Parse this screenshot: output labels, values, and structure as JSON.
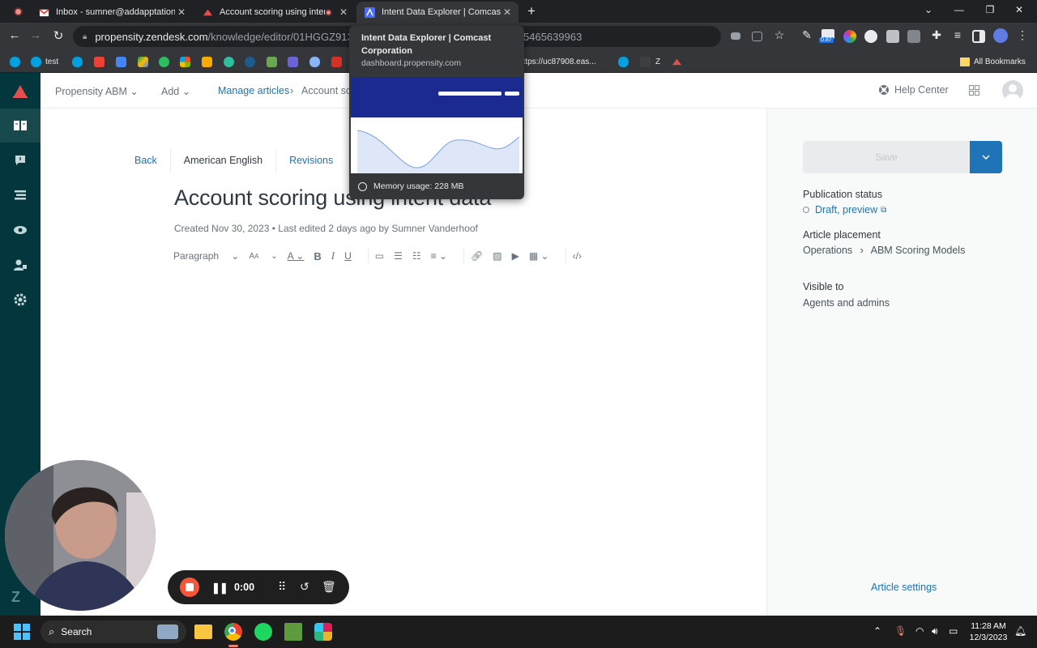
{
  "browser": {
    "tabs": [
      {
        "title": "Inbox - sumner@addapptation.co",
        "active": false
      },
      {
        "title": "Account scoring using intent",
        "active": false
      },
      {
        "title": "Intent Data Explorer | Comcast C",
        "active": true
      }
    ],
    "url_host": "propensity.zendesk.com",
    "url_path": "/knowledge/editor/01HGGZ913EQ7M",
    "url_tail": "5465639963",
    "extension_badge": "0.87",
    "bookmarks": {
      "test": "test",
      "uc_link": "https://uc87908.eas...",
      "z": "Z",
      "all_bookmarks": "All Bookmarks"
    }
  },
  "hovercard": {
    "title": "Intent Data Explorer | Comcast Corporation",
    "domain": "dashboard.propensity.com",
    "memory": "Memory usage: 228 MB"
  },
  "header": {
    "workspace": "Propensity ABM",
    "add": "Add",
    "manage_articles": "Manage articles",
    "breadcrumb_current": "Account sco",
    "help_center": "Help Center"
  },
  "editor": {
    "back": "Back",
    "language": "American English",
    "revisions": "Revisions",
    "title": "Account scoring using intent data",
    "meta": "Created Nov 30, 2023 • Last edited 2 days ago by Sumner Vanderhoof",
    "paragraph_select": "Paragraph"
  },
  "sidebar": {
    "save": "Save",
    "publication_status_label": "Publication status",
    "publication_status_value": "Draft, preview",
    "placement_label": "Article placement",
    "placement_parent": "Operations",
    "placement_child": "ABM Scoring Models",
    "visible_label": "Visible to",
    "visible_value": "Agents and admins",
    "settings_link": "Article settings"
  },
  "recorder": {
    "time": "0:00"
  },
  "taskbar": {
    "search": "Search",
    "time": "11:28 AM",
    "date": "12/3/2023"
  },
  "colors": {
    "rail": "#03363d",
    "accent": "#1f73b7",
    "record": "#f5563a"
  }
}
